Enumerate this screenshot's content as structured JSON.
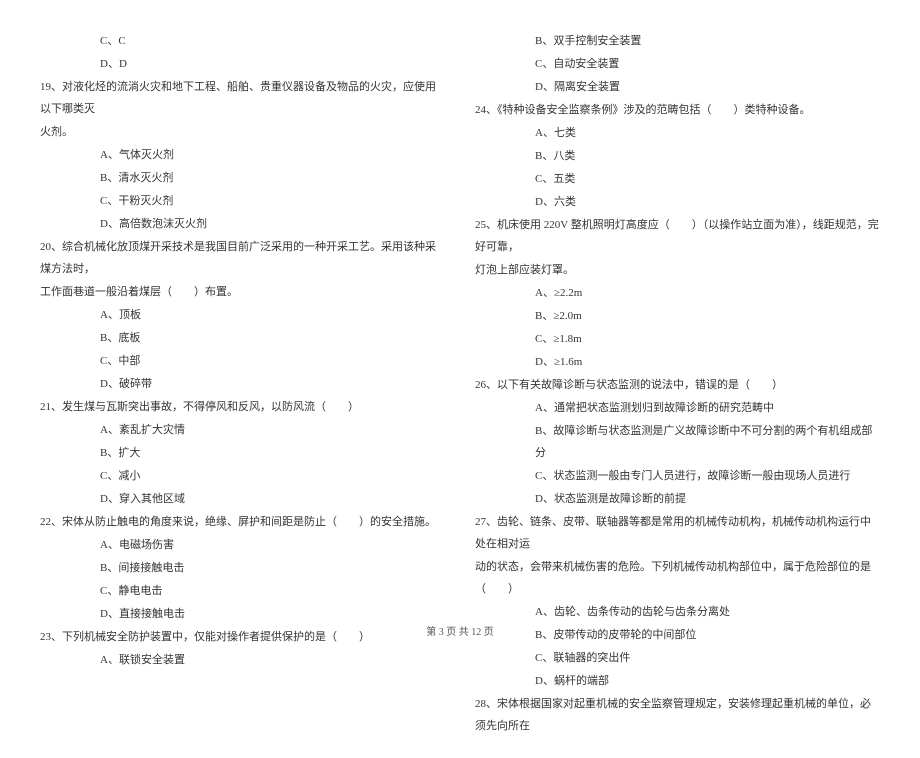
{
  "left": {
    "pre": [
      "C、C",
      "D、D"
    ],
    "q19": {
      "text": "19、对液化烃的流淌火灾和地下工程、船舶、贵重仪器设备及物品的火灾，应使用以下哪类灭",
      "text2": "火剂。",
      "opts": [
        "A、气体灭火剂",
        "B、清水灭火剂",
        "C、干粉灭火剂",
        "D、高倍数泡沫灭火剂"
      ]
    },
    "q20": {
      "text": "20、综合机械化放顶煤开采技术是我国目前广泛采用的一种开采工艺。采用该种采煤方法时，",
      "text2": "工作面巷道一般沿着煤层（　　）布置。",
      "opts": [
        "A、顶板",
        "B、底板",
        "C、中部",
        "D、破碎带"
      ]
    },
    "q21": {
      "text": "21、发生煤与瓦斯突出事故，不得停风和反风，以防风流（　　）",
      "opts": [
        "A、紊乱扩大灾情",
        "B、扩大",
        "C、减小",
        "D、穿入其他区域"
      ]
    },
    "q22": {
      "text": "22、宋体从防止触电的角度来说，绝缘、屏护和间距是防止（　　）的安全措施。",
      "opts": [
        "A、电磁场伤害",
        "B、间接接触电击",
        "C、静电电击",
        "D、直接接触电击"
      ]
    },
    "q23": {
      "text": "23、下列机械安全防护装置中，仅能对操作者提供保护的是（　　）",
      "opts": [
        "A、联锁安全装置"
      ]
    }
  },
  "right": {
    "pre": [
      "B、双手控制安全装置",
      "C、自动安全装置",
      "D、隔离安全装置"
    ],
    "q24": {
      "text": "24、《特种设备安全监察条例》涉及的范畴包括（　　）类特种设备。",
      "opts": [
        "A、七类",
        "B、八类",
        "C、五类",
        "D、六类"
      ]
    },
    "q25": {
      "text": "25、机床使用 220V 整机照明灯高度应（　　）（以操作站立面为准），线距规范，完好可靠，",
      "text2": "灯泡上部应装灯罩。",
      "opts": [
        "A、≥2.2m",
        "B、≥2.0m",
        "C、≥1.8m",
        "D、≥1.6m"
      ]
    },
    "q26": {
      "text": "26、以下有关故障诊断与状态监测的说法中，错误的是（　　）",
      "opts": [
        "A、通常把状态监测划归到故障诊断的研究范畴中",
        "B、故障诊断与状态监测是广义故障诊断中不可分割的两个有机组成部分",
        "C、状态监测一般由专门人员进行，故障诊断一般由现场人员进行",
        "D、状态监测是故障诊断的前提"
      ]
    },
    "q27": {
      "text": "27、齿轮、链条、皮带、联轴器等都是常用的机械传动机构，机械传动机构运行中处在相对运",
      "text2": "动的状态，会带来机械伤害的危险。下列机械传动机构部位中，属于危险部位的是（　　）",
      "opts": [
        "A、齿轮、齿条传动的齿轮与齿条分离处",
        "B、皮带传动的皮带轮的中间部位",
        "C、联轴器的突出件",
        "D、蜗杆的端部"
      ]
    },
    "q28": {
      "text": "28、宋体根据国家对起重机械的安全监察管理规定，安装修理起重机械的单位，必须先向所在"
    }
  },
  "footer": "第 3 页 共 12 页"
}
